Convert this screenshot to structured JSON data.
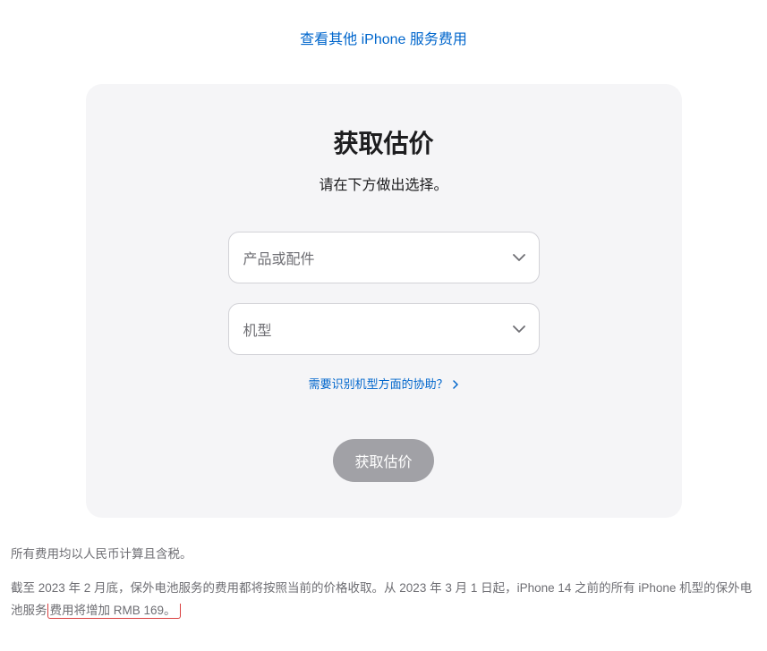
{
  "topLink": "查看其他 iPhone 服务费用",
  "card": {
    "title": "获取估价",
    "subtitle": "请在下方做出选择。",
    "productPlaceholder": "产品或配件",
    "modelPlaceholder": "机型",
    "helpLink": "需要识别机型方面的协助？",
    "submitLabel": "获取估价"
  },
  "footer": {
    "line1": "所有费用均以人民币计算且含税。",
    "line2_part1": "截至 2023 年 2 月底，保外电池服务的费用都将按照当前的价格收取。从 2023 年 3 月 1 日起，iPhone 14 之前的所有 iPhone 机型的保外电池服务",
    "line2_highlight": "费用将增加 RMB 169。"
  }
}
